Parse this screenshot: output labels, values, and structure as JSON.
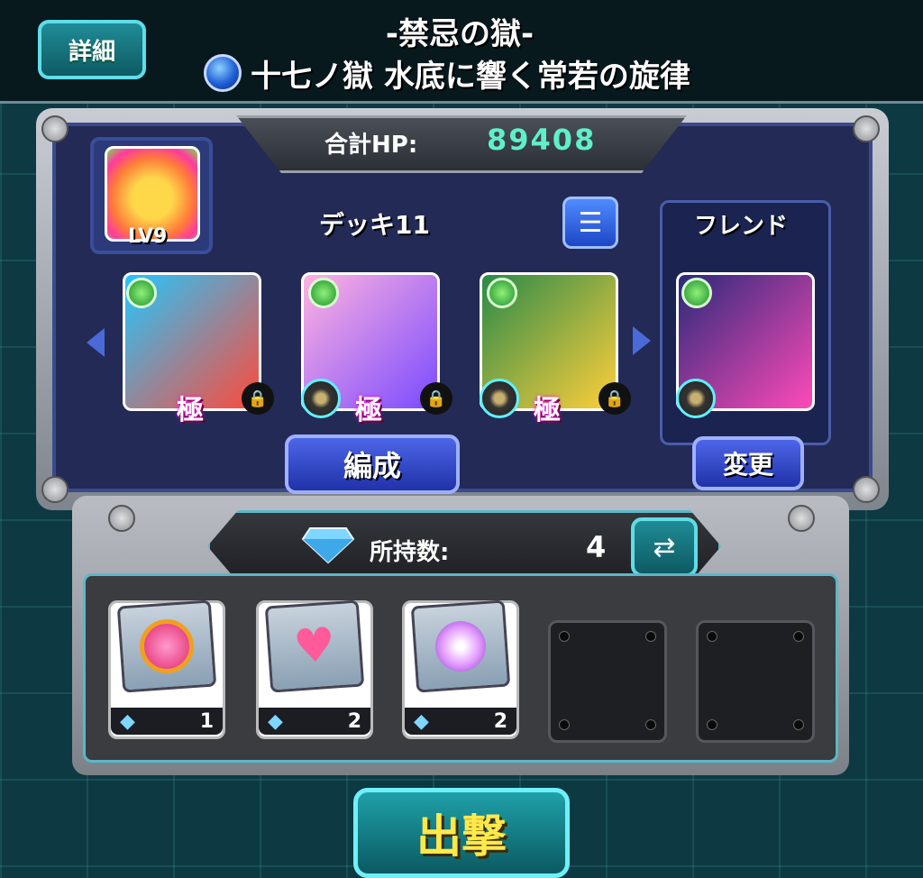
{
  "header": {
    "detail_label": "詳細",
    "title": "-禁忌の獄-",
    "subtitle": "十七ノ獄 水底に響く常若の旋律"
  },
  "deck": {
    "total_hp_label": "合計HP:",
    "total_hp_value": "89408",
    "leader_level": "LV9",
    "deck_name": "デッキ11",
    "friend_label": "フレンド",
    "edit_label": "編成",
    "change_label": "変更",
    "slots": [
      {
        "name": "slot-doraemon",
        "badge": "極",
        "colors": [
          "#22c7ff",
          "#ff4a3a"
        ]
      },
      {
        "name": "slot-pink-hair",
        "badge": "極",
        "colors": [
          "#ffb3e0",
          "#7a4aff"
        ]
      },
      {
        "name": "slot-green-hair",
        "badge": "極",
        "colors": [
          "#2a8a4a",
          "#ffcf3a"
        ]
      }
    ],
    "friend_slot": {
      "colors": [
        "#2a2a7a",
        "#ff4ab8"
      ]
    }
  },
  "items": {
    "gem_label": "所持数:",
    "gem_count": "4",
    "cards": [
      {
        "count": "1",
        "color": "#ff4a8a"
      },
      {
        "count": "2",
        "color": "#ff5a9a"
      },
      {
        "count": "2",
        "color": "#e6a0ff"
      }
    ]
  },
  "sortie_label": "出撃"
}
